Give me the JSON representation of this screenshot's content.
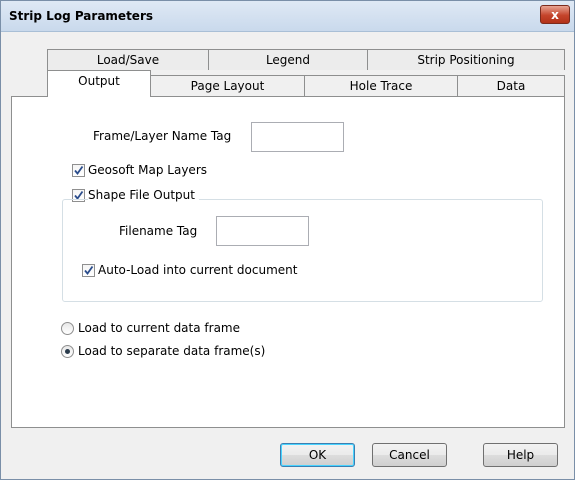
{
  "window": {
    "title": "Strip Log Parameters",
    "close_glyph": "x"
  },
  "tabs": {
    "row1": [
      "Load/Save",
      "Legend",
      "Strip Positioning"
    ],
    "row2": [
      "Output",
      "Page Layout",
      "Hole Trace",
      "Data"
    ],
    "selected": "Output"
  },
  "output": {
    "frame_tag_label": "Frame/Layer Name Tag",
    "frame_tag_value": "",
    "geosoft_label": "Geosoft Map Layers",
    "geosoft_checked": true,
    "shape_label": "Shape File Output",
    "shape_checked": true,
    "filename_tag_label": "Filename Tag",
    "filename_tag_value": "",
    "autoload_label": "Auto-Load into current document",
    "autoload_checked": true,
    "radio_current_label": "Load to current data frame",
    "radio_separate_label": "Load to separate data frame(s)",
    "radio_selected": "separate"
  },
  "buttons": {
    "ok": "OK",
    "cancel": "Cancel",
    "help": "Help"
  }
}
